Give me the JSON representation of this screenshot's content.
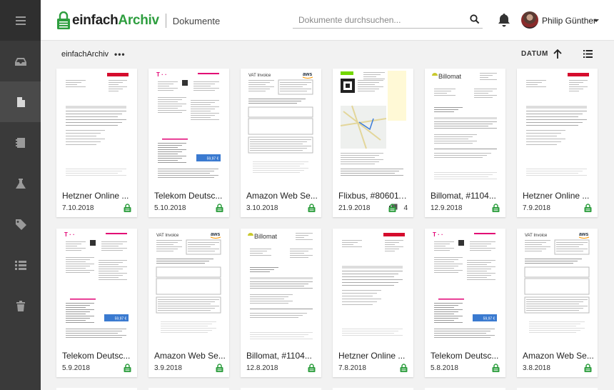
{
  "app": {
    "brand_left": "einfach",
    "brand_right": "Archiv",
    "section": "Dokumente"
  },
  "search": {
    "placeholder": "Dokumente durchsuchen..."
  },
  "user": {
    "name": "Philip Günther"
  },
  "toolbar": {
    "breadcrumb": "einfachArchiv",
    "more": "•••",
    "sort_label": "DATUM"
  },
  "colors": {
    "accent_green": "#2e9e3f",
    "sidebar": "#3a3a3a",
    "hetzner_red": "#d50c2d",
    "telekom_magenta": "#e20074",
    "aws_orange": "#ff9900"
  },
  "sidebar": {
    "items": [
      {
        "icon": "inbox-icon"
      },
      {
        "icon": "document-icon"
      },
      {
        "icon": "notebook-icon"
      },
      {
        "icon": "flask-icon"
      },
      {
        "icon": "tag-icon"
      },
      {
        "icon": "list-icon"
      },
      {
        "icon": "trash-icon"
      }
    ]
  },
  "documents": [
    {
      "title": "Hetzner Online ...",
      "date": "7.10.2018",
      "kind": "hetzner",
      "pages": ""
    },
    {
      "title": "Telekom Deutsc...",
      "date": "5.10.2018",
      "kind": "telekom",
      "pages": ""
    },
    {
      "title": "Amazon Web Se...",
      "date": "3.10.2018",
      "kind": "aws",
      "pages": ""
    },
    {
      "title": "Flixbus, #806011...",
      "date": "21.9.2018",
      "kind": "flixbus",
      "pages": "4"
    },
    {
      "title": "Billomat, #1104...",
      "date": "12.9.2018",
      "kind": "billomat",
      "pages": ""
    },
    {
      "title": "Hetzner Online ...",
      "date": "7.9.2018",
      "kind": "hetzner",
      "pages": ""
    },
    {
      "title": "Telekom Deutsc...",
      "date": "5.9.2018",
      "kind": "telekom",
      "pages": ""
    },
    {
      "title": "Amazon Web Se...",
      "date": "3.9.2018",
      "kind": "aws",
      "pages": ""
    },
    {
      "title": "Billomat, #1104...",
      "date": "12.8.2018",
      "kind": "billomat",
      "pages": ""
    },
    {
      "title": "Hetzner Online ...",
      "date": "7.8.2018",
      "kind": "hetzner",
      "pages": ""
    },
    {
      "title": "Telekom Deutsc...",
      "date": "5.8.2018",
      "kind": "telekom",
      "pages": ""
    },
    {
      "title": "Amazon Web Se...",
      "date": "3.8.2018",
      "kind": "aws",
      "pages": ""
    }
  ]
}
